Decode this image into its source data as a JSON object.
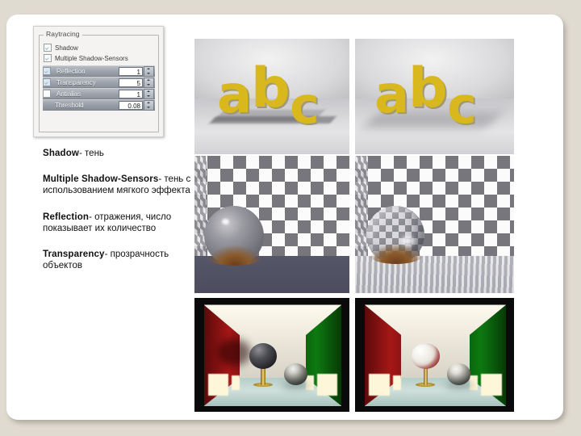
{
  "slide": {
    "background_color": "#e0dbd1",
    "card_color": "#ffffff"
  },
  "panel": {
    "group_title": "Raytracing",
    "checkboxes": [
      {
        "label": "Shadow",
        "checked": true
      },
      {
        "label": "Multiple Shadow-Sensors",
        "checked": true
      }
    ],
    "value_rows": [
      {
        "label": "Reflection",
        "checked": true,
        "value": "1",
        "has_checkbox": true
      },
      {
        "label": "Transparency",
        "checked": true,
        "value": "5",
        "has_checkbox": true
      },
      {
        "label": "Antialias",
        "checked": false,
        "value": "1",
        "has_checkbox": true
      },
      {
        "label": "Threshold",
        "checked": false,
        "value": "0.08",
        "has_checkbox": false
      }
    ]
  },
  "description": {
    "items": [
      {
        "term": "Shadow",
        "dash": "- ",
        "text": "тень"
      },
      {
        "term": "Multiple Shadow-Sensors",
        "dash": "- ",
        "text": "тень с использованием мягкого эффекта"
      },
      {
        "term": "Reflection",
        "dash": "- ",
        "text": "отражения, число показывает их количество"
      },
      {
        "term": "Transparency",
        "dash": "- ",
        "text": "прозрачность объектов"
      }
    ]
  },
  "gallery": {
    "images": [
      {
        "name": "abc-hard-shadow",
        "caption": "3D letters abc with hard shadow"
      },
      {
        "name": "abc-soft-shadow",
        "caption": "3D letters abc with soft shadow"
      },
      {
        "name": "sphere-no-reflection",
        "caption": "Matte sphere on checkered wall, no reflection"
      },
      {
        "name": "sphere-with-reflection",
        "caption": "Mirror sphere and reflective floor"
      },
      {
        "name": "room-opaque-sphere",
        "caption": "Cornell box room with opaque sphere"
      },
      {
        "name": "room-transparent-sphere",
        "caption": "Cornell box room with transparent sphere"
      }
    ]
  }
}
